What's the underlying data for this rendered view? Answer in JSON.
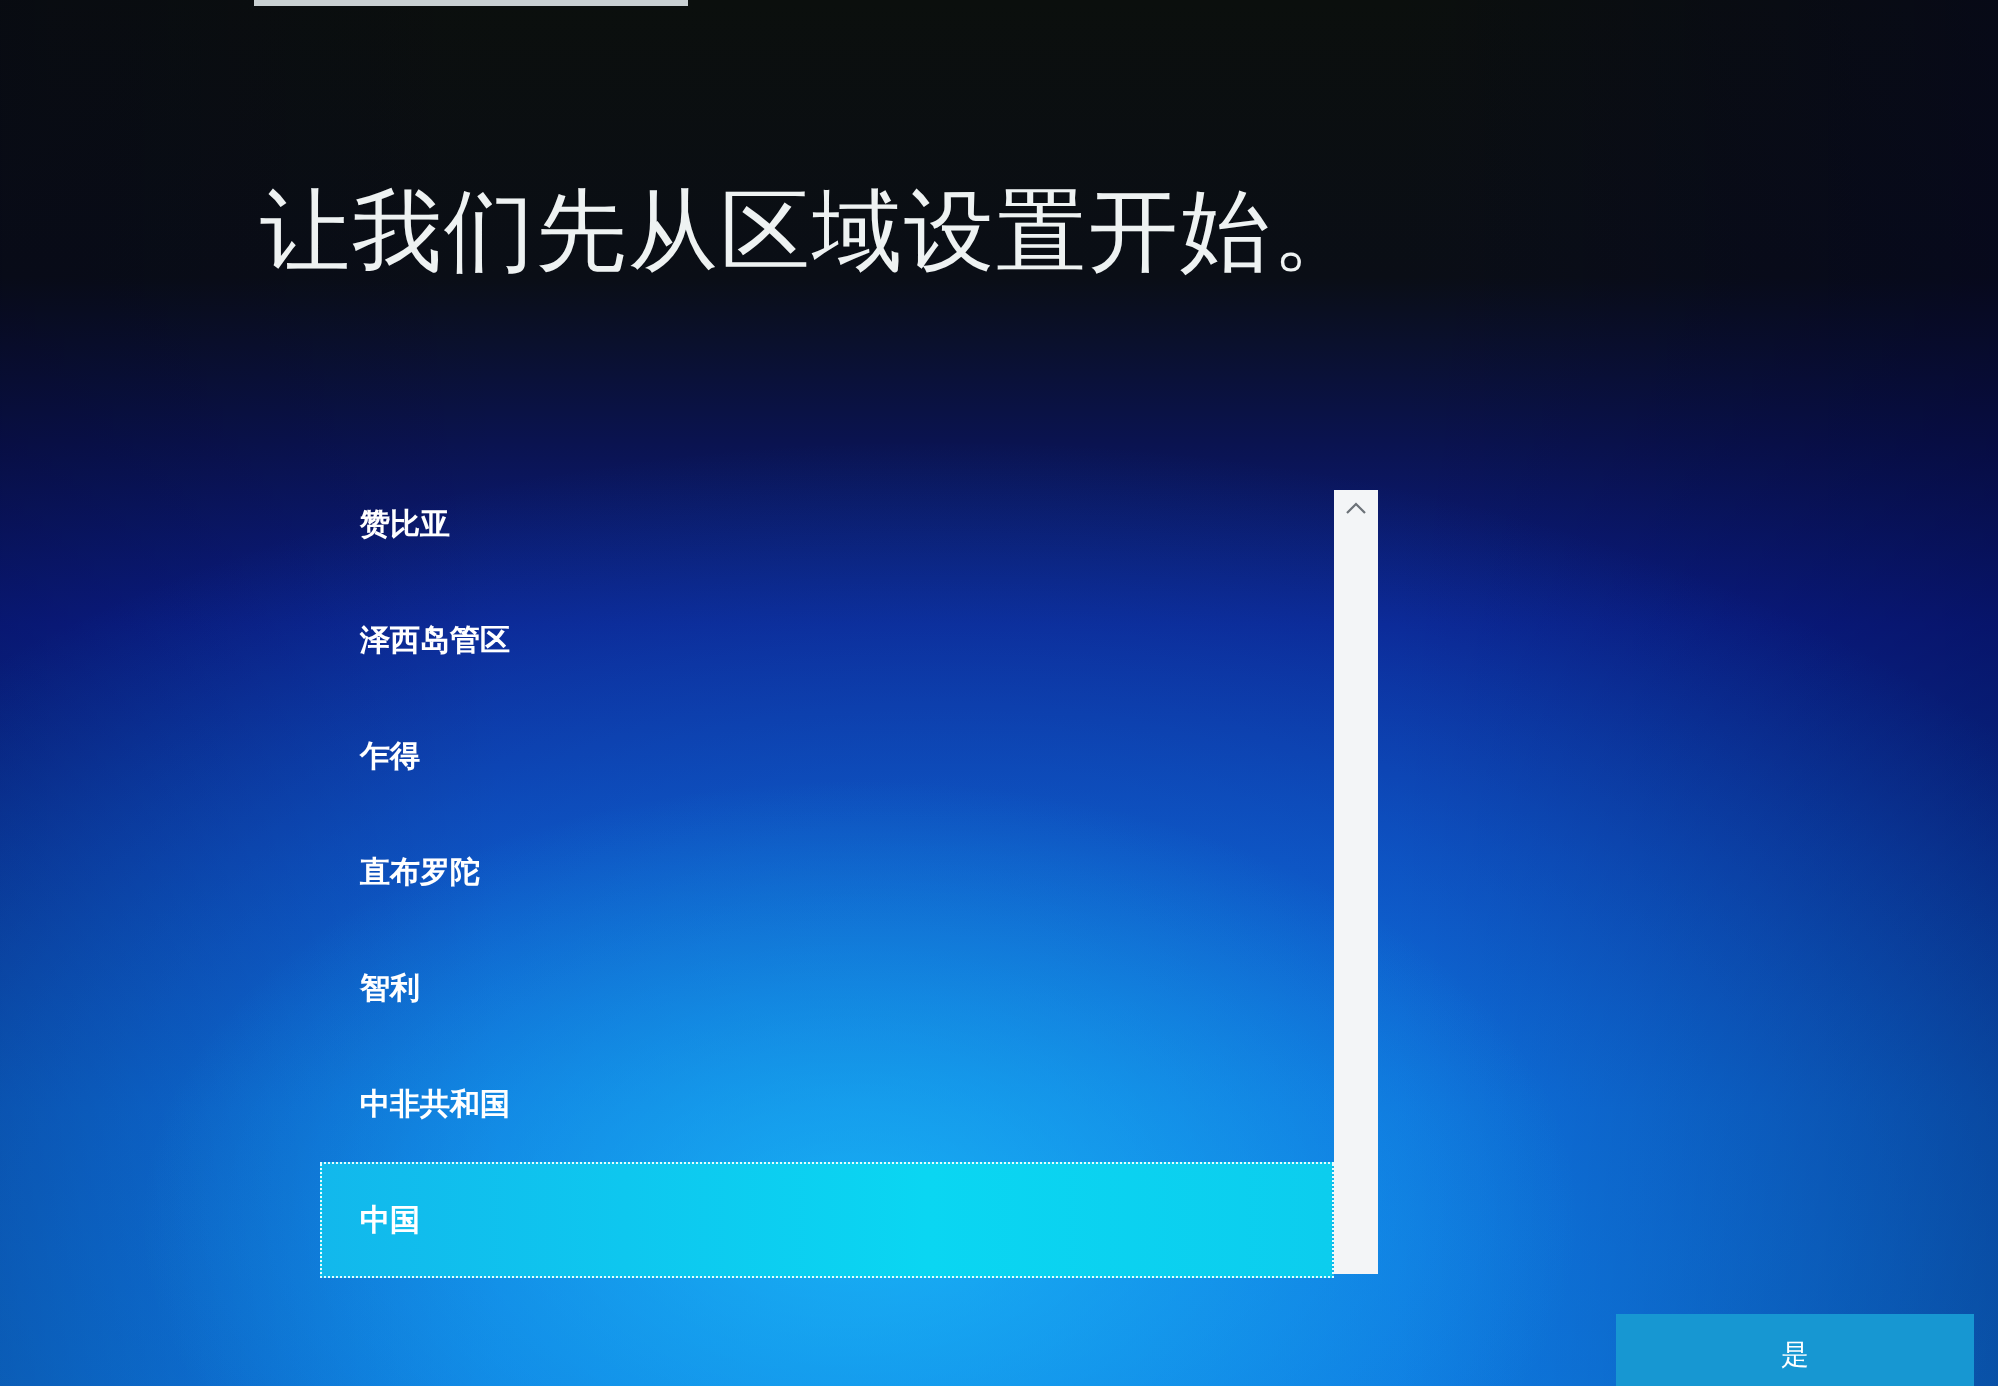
{
  "title": "让我们先从区域设置开始。",
  "regions": [
    {
      "label": "赞比亚",
      "selected": false
    },
    {
      "label": "泽西岛管区",
      "selected": false
    },
    {
      "label": "乍得",
      "selected": false
    },
    {
      "label": "直布罗陀",
      "selected": false
    },
    {
      "label": "智利",
      "selected": false
    },
    {
      "label": "中非共和国",
      "selected": false
    },
    {
      "label": "中国",
      "selected": true
    }
  ],
  "primary_button": {
    "label": "是"
  }
}
